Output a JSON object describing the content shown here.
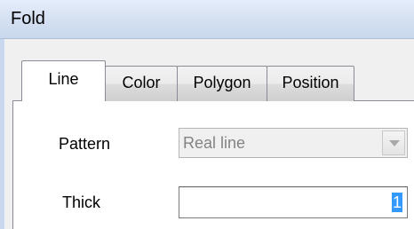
{
  "window": {
    "title": "Fold"
  },
  "tabs": [
    {
      "label": "Line",
      "active": true
    },
    {
      "label": "Color",
      "active": false
    },
    {
      "label": "Polygon",
      "active": false
    },
    {
      "label": "Position",
      "active": false
    }
  ],
  "form": {
    "pattern": {
      "label": "Pattern",
      "value": "Real line",
      "disabled": true
    },
    "thick": {
      "label": "Thick",
      "value": "1"
    }
  }
}
